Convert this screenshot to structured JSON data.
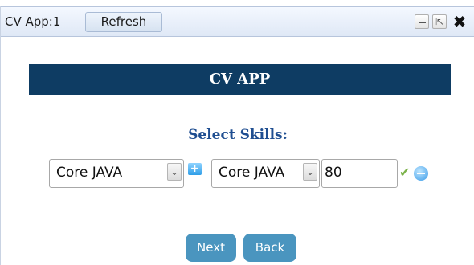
{
  "window": {
    "title": "CV App:1",
    "refresh_label": "Refresh",
    "controls": {
      "minimize_icon": "minimize-icon",
      "popout_icon": "popout-icon",
      "close_icon": "close-icon",
      "close_glyph": "✖",
      "popout_glyph": "⇱"
    }
  },
  "banner": {
    "title": "CV APP"
  },
  "skills_form": {
    "label": "Select Skills:",
    "skill_category": {
      "selected": "Core JAVA"
    },
    "skill_name": {
      "selected": "Core JAVA"
    },
    "score": {
      "value": "80"
    },
    "add_icon": "plus-icon",
    "add_glyph": "+",
    "confirm_icon": "checkmark-icon",
    "confirm_glyph": "✔",
    "remove_icon": "minus-icon"
  },
  "navigation": {
    "next_label": "Next",
    "back_label": "Back"
  },
  "colors": {
    "banner_bg": "#0e3c63",
    "label_color": "#1f4e91",
    "button_bg": "#4a95bf",
    "check_green": "#7bb24a"
  }
}
